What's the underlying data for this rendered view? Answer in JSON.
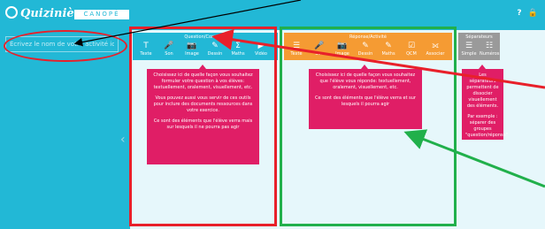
{
  "app": {
    "logo": "Quizinière",
    "badge": "CANOPÉ"
  },
  "topbar": {
    "help_icon": "?",
    "lock_icon": "🔒"
  },
  "name_input": {
    "placeholder": "Écrivez le nom de votre activité ici"
  },
  "question_group": {
    "title": "Question/Consigne",
    "tools": [
      {
        "label": "Texte",
        "icon": "T"
      },
      {
        "label": "Son",
        "icon": "🎤"
      },
      {
        "label": "Image",
        "icon": "📷"
      },
      {
        "label": "Dessin",
        "icon": "✎"
      },
      {
        "label": "Maths",
        "icon": "Σ"
      },
      {
        "label": "Vidéo",
        "icon": "▶"
      }
    ]
  },
  "response_group": {
    "title": "Réponse/Activité",
    "tools": [
      {
        "label": "Texte",
        "icon": "☰"
      },
      {
        "label": "Son",
        "icon": "🎤"
      },
      {
        "label": "Image",
        "icon": "📷"
      },
      {
        "label": "Dessin",
        "icon": "✎"
      },
      {
        "label": "Maths",
        "icon": "✎"
      },
      {
        "label": "QCM",
        "icon": "☑"
      },
      {
        "label": "Associer",
        "icon": "⟗"
      }
    ]
  },
  "separator_group": {
    "title": "Séparateurs",
    "tools": [
      {
        "label": "Simple",
        "icon": "☰"
      },
      {
        "label": "Numéros",
        "icon": "☷"
      }
    ]
  },
  "tooltips": {
    "question": [
      "Choisissez ici de quelle façon vous souhaitez formuler votre question à vos élèves: textuellement, oralement, visuellement, etc.",
      "Vous pouvez aussi vous servir de ces outils pour inclure des documents ressources dans votre exercice.",
      "Ce sont des éléments que l'élève verra mais sur lesquels il ne pourra pas agir"
    ],
    "response": [
      "Choisissez ici de quelle façon vous souhaitez que l'élève vous réponde: textuellement, oralement, visuellement, etc.",
      "Ce sont des éléments que l'élève verra et sur lesquels il pourra agir"
    ],
    "separator": [
      "Les séparateurs permettent de dissocier visuellement des éléments.",
      "Par exemple : séparer des groupes \"question/réponse\""
    ]
  },
  "colors": {
    "topbar": "#22b8d6",
    "question_group": "#22b8d6",
    "response_group": "#f59b33",
    "separator_group": "#9a9a9a",
    "tooltip": "#e01e66",
    "annotation_red": "#e8202a",
    "annotation_green": "#21b04b"
  }
}
